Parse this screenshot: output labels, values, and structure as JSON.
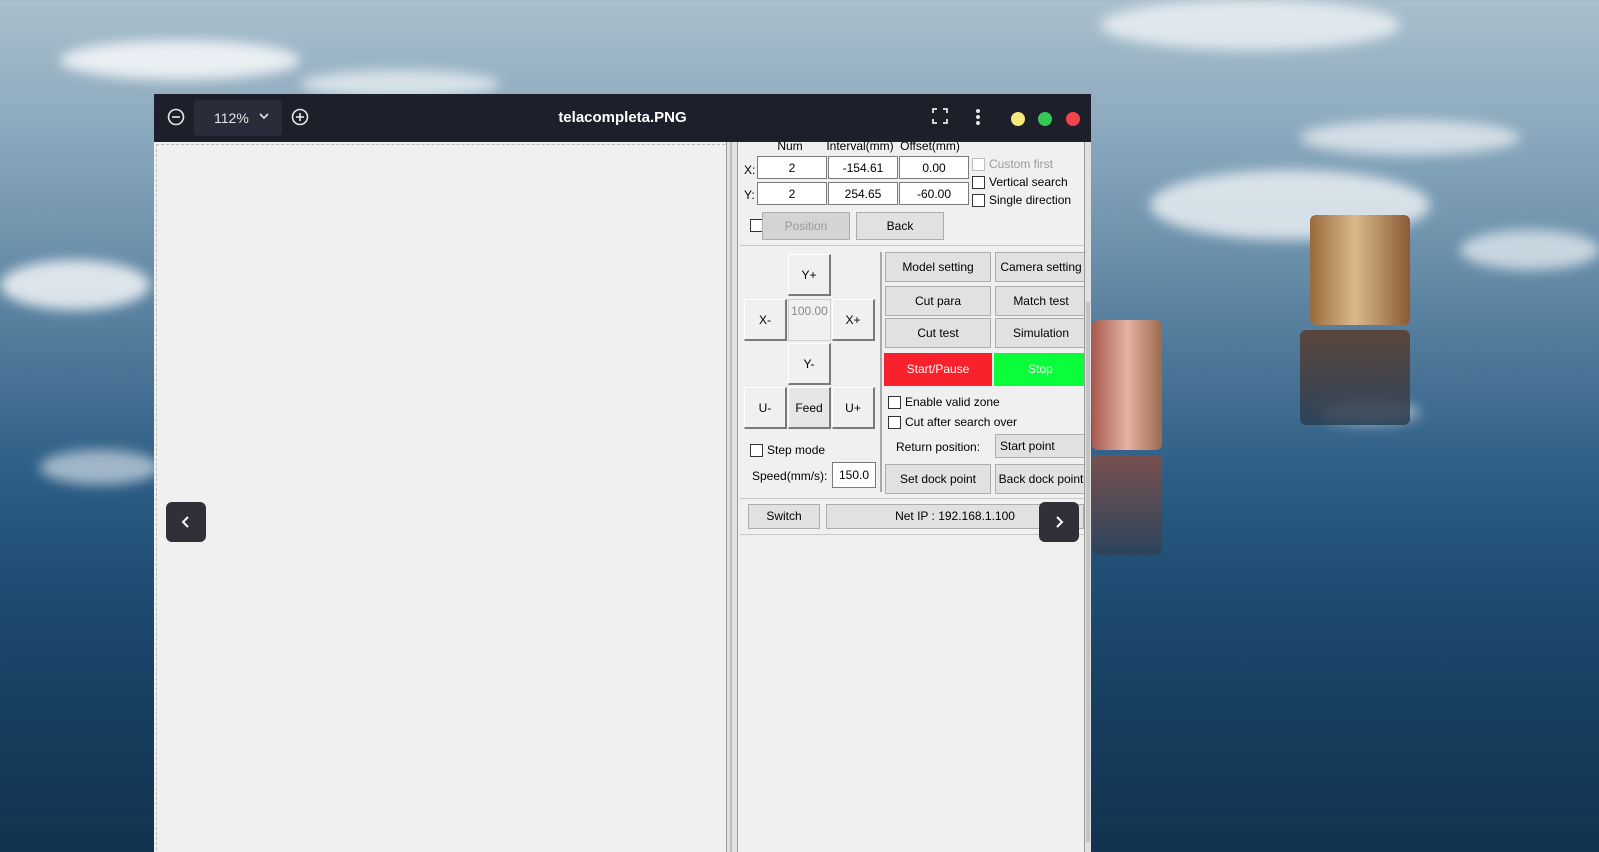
{
  "viewer": {
    "title": "telacompleta.PNG",
    "zoom": "112%",
    "icons": [
      "zoom-out-icon",
      "zoom-in-icon",
      "fullscreen-icon",
      "more-options-icon",
      "chevron-down-icon"
    ],
    "window_dots": {
      "minimize": "#f5e97a",
      "maximize": "#36c857",
      "close": "#f2424a"
    }
  },
  "panel": {
    "headers": {
      "num": "Num",
      "interval": "Interval(mm)",
      "offset": "Offset(mm)"
    },
    "row_x": {
      "label": "X:",
      "num": "2",
      "interval": "-154.61",
      "offset": "0.00"
    },
    "row_y": {
      "label": "Y:",
      "num": "2",
      "interval": "254.65",
      "offset": "-60.00"
    },
    "custom_first": "Custom first",
    "vertical_search": "Vertical search",
    "single_direction": "Single direction",
    "position_btn": "Position",
    "back_btn": "Back",
    "jog": {
      "y_plus": "Y+",
      "y_minus": "Y-",
      "x_minus": "X-",
      "x_plus": "X+",
      "step_value": "100.00",
      "u_minus": "U-",
      "feed": "Feed",
      "u_plus": "U+"
    },
    "step_mode": "Step mode",
    "speed_label": "Speed(mm/s):",
    "speed_value": "150.0",
    "model_setting": "Model setting",
    "camera_setting": "Camera setting",
    "cut_para": "Cut para",
    "match_test": "Match test",
    "cut_test": "Cut test",
    "simulation": "Simulation",
    "start_pause": "Start/Pause",
    "stop": "Stop",
    "enable_valid_zone": "Enable valid zone",
    "cut_after_search": "Cut after search over",
    "return_position_label": "Return position:",
    "return_position_value": "Start point",
    "set_dock_point": "Set dock point",
    "back_dock_point": "Back dock point",
    "switch": "Switch",
    "net_ip": "Net IP : 192.168.1.100"
  },
  "colors": {
    "start_pause": "#f8212c",
    "stop": "#0aff3a",
    "titlebar": "#1d1f2b"
  }
}
